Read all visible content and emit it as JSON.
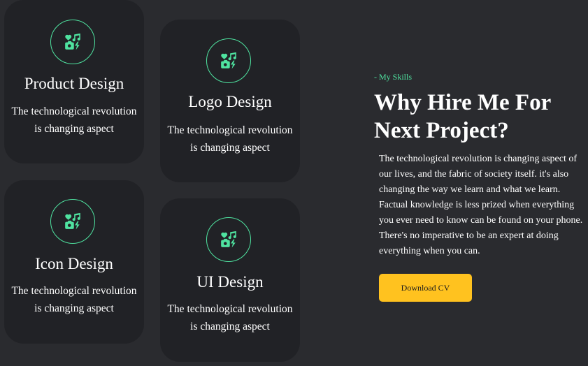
{
  "accent_color": "#4fe3a0",
  "button_color": "#ffc21f",
  "cards": [
    {
      "icon": "heart-music-camera-icon",
      "title": "Product Design",
      "description": "The technological revolution is changing aspect"
    },
    {
      "icon": "heart-music-camera-icon",
      "title": "Logo Design",
      "description": "The technological revolution is changing aspect"
    },
    {
      "icon": "heart-music-camera-icon",
      "title": "Icon Design",
      "description": "The technological revolution is changing aspect"
    },
    {
      "icon": "heart-music-camera-icon",
      "title": "UI Design",
      "description": "The technological revolution is changing aspect"
    }
  ],
  "about": {
    "kicker": "- My Skills",
    "headline": "Why Hire Me For Next Project?",
    "text": "The technological revolution is changing aspect of our lives, and the fabric of society itself. it's also changing the way we learn and what we learn. Factual knowledge is less prized when everything you ever need to know can be found on your phone. There's no imperative to be an expert at doing everything when you can.",
    "button_label": "Download CV"
  }
}
